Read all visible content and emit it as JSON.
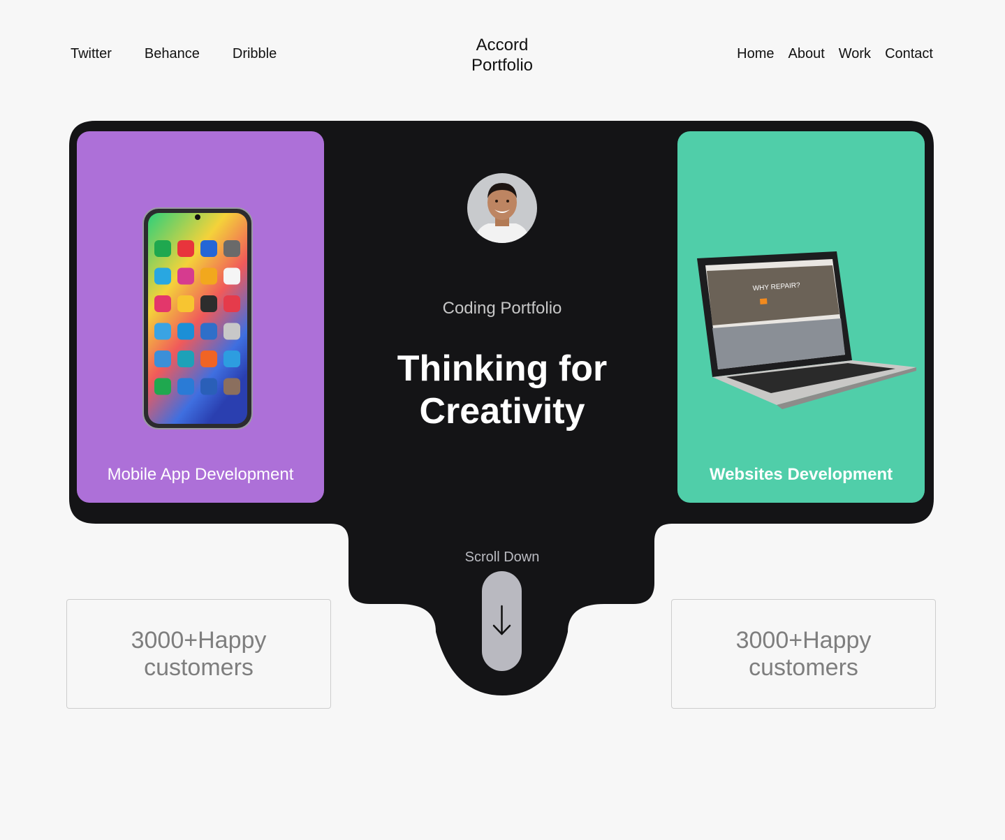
{
  "header": {
    "social_links": [
      "Twitter",
      "Behance",
      "Dribble"
    ],
    "brand_line1": "Accord",
    "brand_line2": "Portfolio",
    "nav_links": [
      "Home",
      "About",
      "Work",
      "Contact"
    ]
  },
  "hero": {
    "left_card_title": "Mobile App Development",
    "right_card_title": "Websites Development",
    "eyebrow": "Coding Portfolio",
    "headline_line1": "Thinking for",
    "headline_line2": "Creativity",
    "scroll_label": "Scroll Down",
    "laptop_screen_text": "WHY REPAIR?",
    "colors": {
      "dark": "#141416",
      "purple_card": "#ad70d8",
      "green_card": "#50cea9",
      "scroll_button": "#b9b9c0"
    }
  },
  "stats": [
    {
      "text": "3000+Happy customers"
    },
    {
      "text": "3000+Happy customers"
    }
  ]
}
